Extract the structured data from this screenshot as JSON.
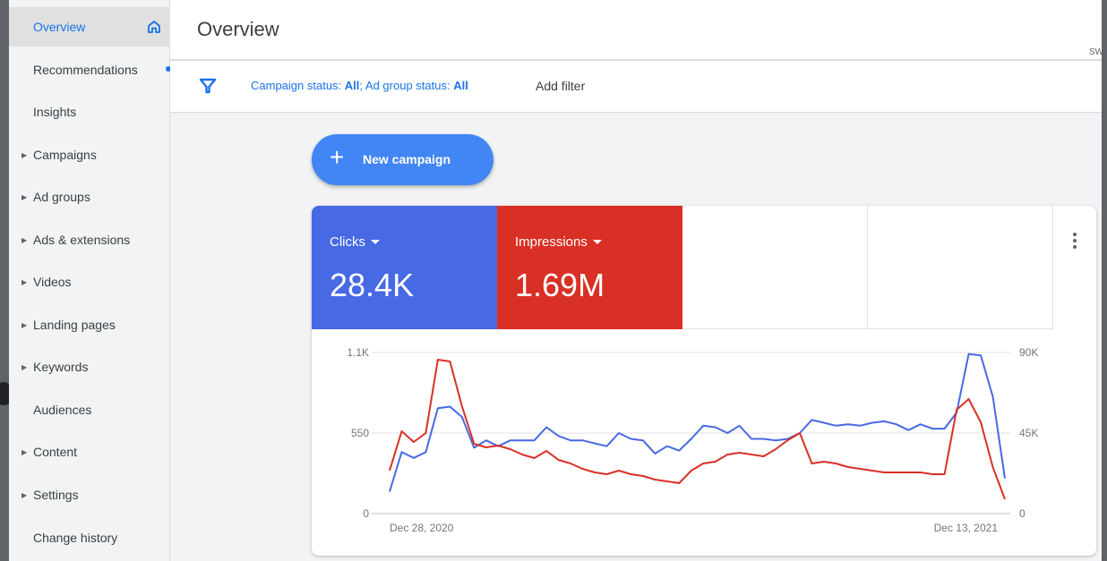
{
  "sidebar": {
    "items": [
      {
        "label": "Overview",
        "has_arrow": false,
        "active": true
      },
      {
        "label": "Recommendations",
        "has_arrow": false,
        "active": false
      },
      {
        "label": "Insights",
        "has_arrow": false,
        "active": false
      },
      {
        "label": "Campaigns",
        "has_arrow": true,
        "active": false
      },
      {
        "label": "Ad groups",
        "has_arrow": true,
        "active": false
      },
      {
        "label": "Ads & extensions",
        "has_arrow": true,
        "active": false
      },
      {
        "label": "Videos",
        "has_arrow": true,
        "active": false
      },
      {
        "label": "Landing pages",
        "has_arrow": true,
        "active": false
      },
      {
        "label": "Keywords",
        "has_arrow": true,
        "active": false
      },
      {
        "label": "Audiences",
        "has_arrow": false,
        "active": false
      },
      {
        "label": "Content",
        "has_arrow": true,
        "active": false
      },
      {
        "label": "Settings",
        "has_arrow": true,
        "active": false
      },
      {
        "label": "Change history",
        "has_arrow": false,
        "active": false
      }
    ],
    "home_icon": "home-icon",
    "recommendations_badge": "unread-dot"
  },
  "page": {
    "title": "Overview",
    "corner_text": "SWI"
  },
  "filter_bar": {
    "icon": "filter-icon",
    "campaign_status_label": "Campaign status: ",
    "campaign_status_value": "All",
    "separator": "; ",
    "ad_group_status_label": "Ad group status: ",
    "ad_group_status_value": "All",
    "add_filter_label": "Add filter"
  },
  "actions": {
    "new_campaign_label": "New campaign"
  },
  "metrics": [
    {
      "label": "Clicks",
      "value": "28.4K",
      "color": "#4769e4"
    },
    {
      "label": "Impressions",
      "value": "1.69M",
      "color": "#d93025"
    }
  ],
  "chart_data": {
    "type": "line",
    "x_start_label": "Dec 28, 2020",
    "x_end_label": "Dec 13, 2021",
    "y_left_ticks": [
      "1.1K",
      "550",
      "0"
    ],
    "y_right_ticks": [
      "90K",
      "45K",
      "0"
    ],
    "y_left_range": [
      0,
      1100
    ],
    "y_right_range": [
      0,
      90000
    ],
    "grid": true,
    "series": [
      {
        "axis": "left",
        "color": "#4769e4",
        "values": [
          150,
          420,
          380,
          420,
          720,
          730,
          660,
          450,
          500,
          460,
          500,
          500,
          500,
          590,
          530,
          500,
          500,
          480,
          460,
          550,
          510,
          500,
          410,
          460,
          430,
          510,
          600,
          590,
          550,
          600,
          510,
          510,
          500,
          510,
          550,
          640,
          620,
          600,
          610,
          600,
          620,
          630,
          610,
          570,
          610,
          580,
          580,
          690,
          1090,
          1080,
          800,
          240
        ]
      },
      {
        "axis": "right",
        "color": "#d93025",
        "values": [
          24000,
          46000,
          40000,
          45000,
          86000,
          85000,
          60000,
          39000,
          37000,
          38000,
          36000,
          33000,
          31000,
          35000,
          30000,
          28000,
          25000,
          23000,
          22000,
          24000,
          22000,
          21000,
          19000,
          18000,
          17000,
          24000,
          28000,
          29000,
          33000,
          34000,
          33000,
          32000,
          36000,
          41000,
          45000,
          28000,
          29000,
          28000,
          26000,
          25000,
          24000,
          23000,
          23000,
          23000,
          23000,
          22000,
          22000,
          58000,
          64000,
          51000,
          26000,
          8000
        ]
      }
    ]
  }
}
